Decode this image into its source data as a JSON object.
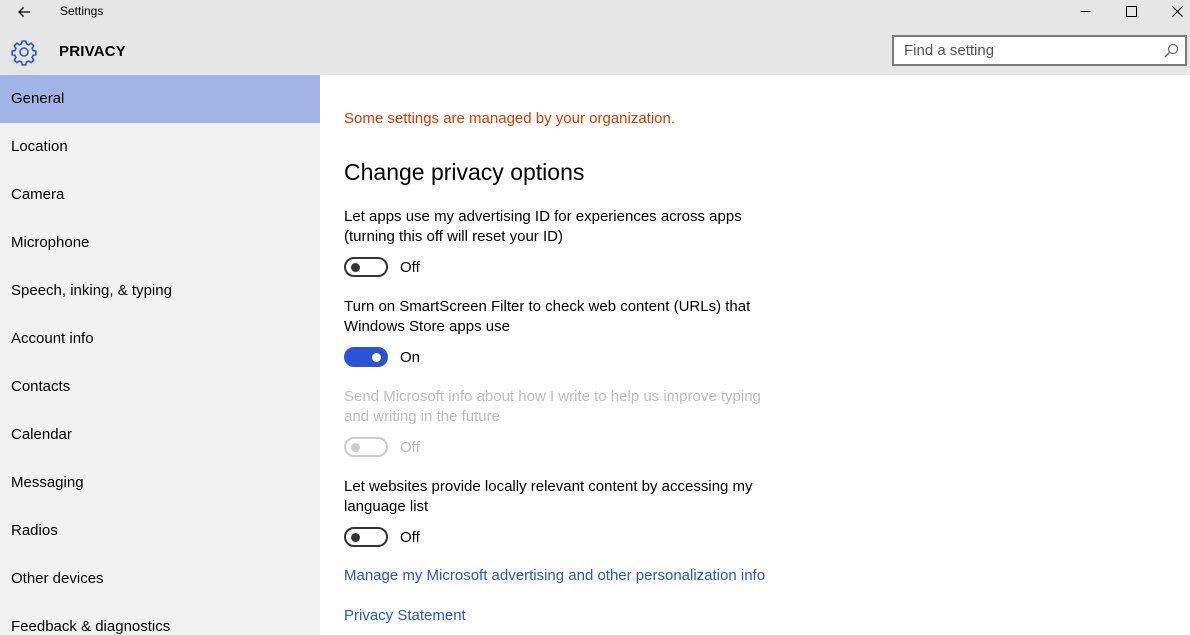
{
  "window": {
    "title": "Settings"
  },
  "header": {
    "title": "PRIVACY",
    "icon": "gear-icon"
  },
  "search": {
    "placeholder": "Find a setting"
  },
  "colors": {
    "accent": "#2b54d4",
    "selected_nav": "#a2b3e6",
    "warning": "#d83b01"
  },
  "sidebar": {
    "items": [
      {
        "label": "General",
        "selected": true
      },
      {
        "label": "Location"
      },
      {
        "label": "Camera"
      },
      {
        "label": "Microphone"
      },
      {
        "label": "Speech, inking, & typing"
      },
      {
        "label": "Account info"
      },
      {
        "label": "Contacts"
      },
      {
        "label": "Calendar"
      },
      {
        "label": "Messaging"
      },
      {
        "label": "Radios"
      },
      {
        "label": "Other devices"
      },
      {
        "label": "Feedback & diagnostics"
      }
    ]
  },
  "main": {
    "warning": "Some settings are managed by your organization.",
    "section_title": "Change privacy options",
    "settings": [
      {
        "label": "Let apps use my advertising ID for experiences across apps (turning this off will reset your ID)",
        "state": "Off",
        "on": false,
        "enabled": true
      },
      {
        "label": "Turn on SmartScreen Filter to check web content (URLs) that Windows Store apps use",
        "state": "On",
        "on": true,
        "enabled": true
      },
      {
        "label": "Send Microsoft info about how I write to help us improve typing and writing in the future",
        "state": "Off",
        "on": false,
        "enabled": false
      },
      {
        "label": "Let websites provide locally relevant content by accessing my language list",
        "state": "Off",
        "on": false,
        "enabled": true
      }
    ],
    "links": [
      {
        "label": "Manage my Microsoft advertising and other personalization info"
      },
      {
        "label": "Privacy Statement"
      }
    ]
  }
}
